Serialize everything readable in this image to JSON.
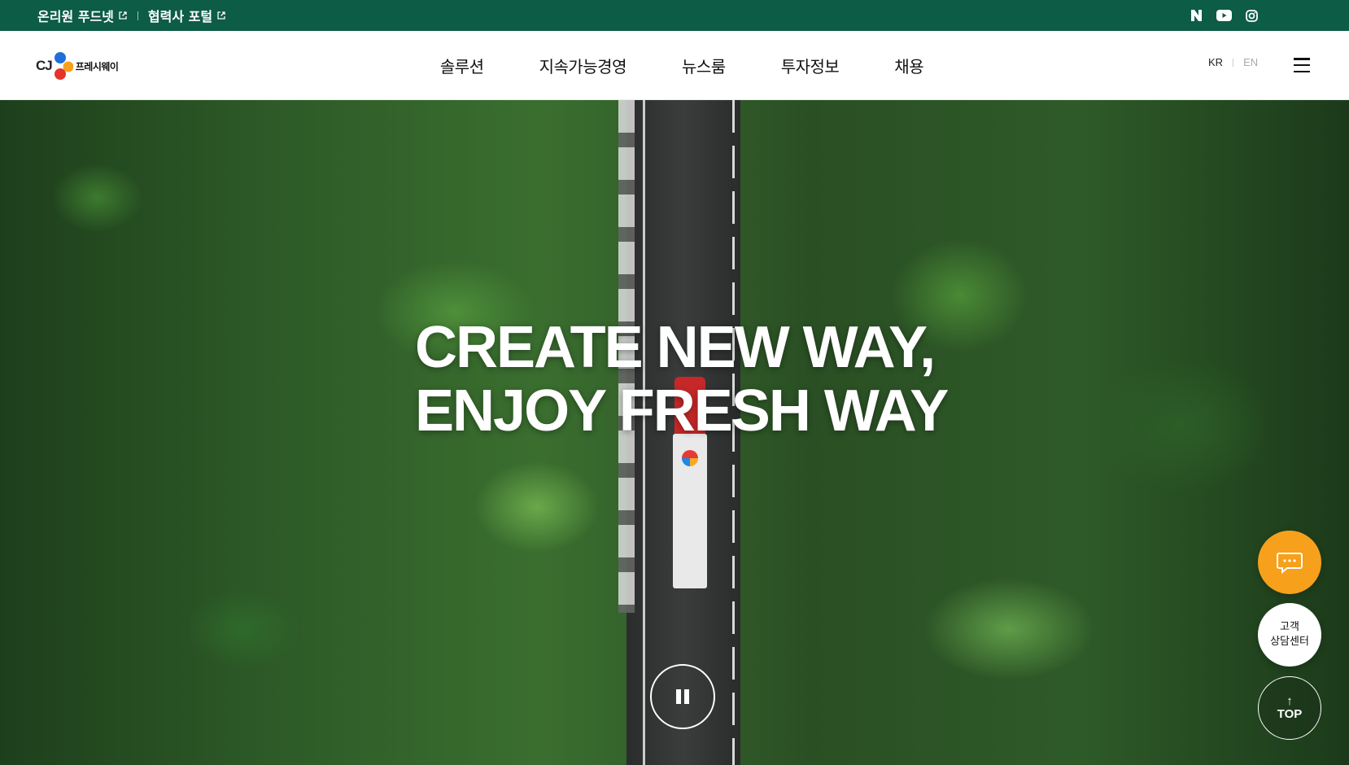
{
  "topbar": {
    "links": [
      {
        "label": "온리원 푸드넷"
      },
      {
        "label": "협력사 포털"
      }
    ],
    "social": [
      "naver-blog-icon",
      "youtube-icon",
      "instagram-icon"
    ],
    "bg_color": "#0c5c46"
  },
  "header": {
    "logo": {
      "mark": "CJ",
      "text": "프레시웨이"
    },
    "nav": [
      "솔루션",
      "지속가능경영",
      "뉴스룸",
      "투자정보",
      "채용"
    ],
    "lang": {
      "kr": "KR",
      "en": "EN"
    }
  },
  "hero": {
    "title_line1": "CREATE NEW WAY,",
    "title_line2": "ENJOY FRESH WAY"
  },
  "floating": {
    "center_line1": "고객",
    "center_line2": "상담센터",
    "top_label": "TOP",
    "top_arrow": "↑",
    "chat_color": "#f7a01c"
  }
}
